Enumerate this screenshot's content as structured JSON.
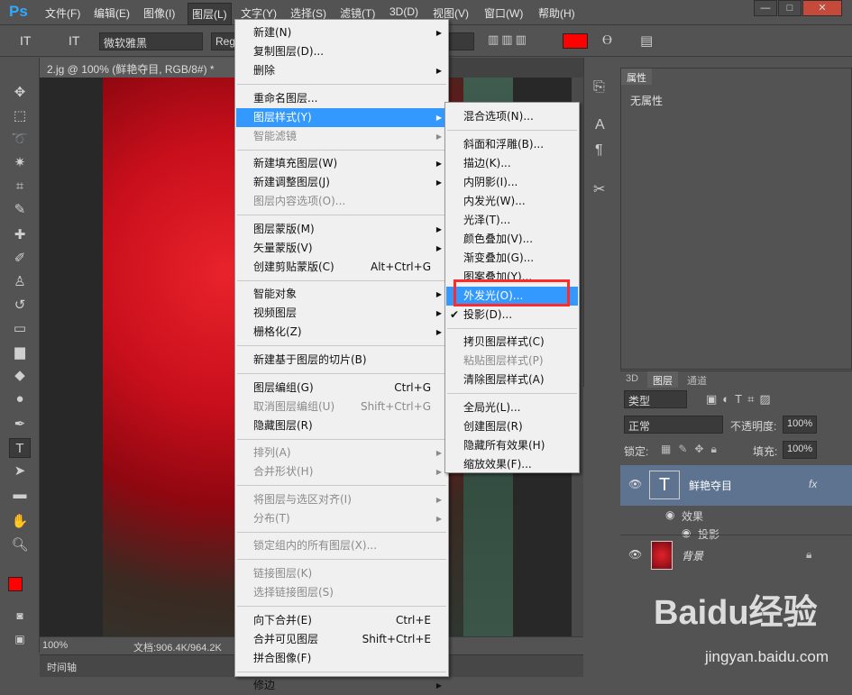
{
  "app": {
    "logo": "Ps"
  },
  "menubar": {
    "items": [
      "文件(F)",
      "编辑(E)",
      "图像(I)",
      "图层(L)",
      "文字(Y)",
      "选择(S)",
      "滤镜(T)",
      "3D(D)",
      "视图(V)",
      "窗口(W)",
      "帮助(H)"
    ],
    "window_buttons": [
      "—",
      "□",
      "✕"
    ]
  },
  "optbar": {
    "tool_glyph": "IT",
    "orient_glyph": "IT",
    "font_family": "微软雅黑",
    "font_style": "Reg",
    "color_hex": "#ff0000"
  },
  "document": {
    "tab_title": "2.jg @ 100% (鲜艳夺目, RGB/8#) *",
    "zoom": "100%",
    "doc_info": "文档:906.4K/964.2K",
    "timeline_label": "时间轴"
  },
  "properties": {
    "tab": "属性",
    "content": "无属性"
  },
  "layers": {
    "tabs": [
      "3D",
      "图层",
      "通道"
    ],
    "filter_kind": "类型",
    "blend_mode": "正常",
    "opacity_label": "不透明度:",
    "opacity": "100%",
    "lock_label": "锁定:",
    "fill_label": "填充:",
    "fill": "100%",
    "text_layer": {
      "name": "鲜艳夺目",
      "fx": "fx",
      "effects_label": "效果",
      "effect_item": "投影"
    },
    "bg_layer": {
      "name": "背景"
    }
  },
  "layer_menu": {
    "items": [
      {
        "label": "新建(N)",
        "sub": true
      },
      {
        "label": "复制图层(D)..."
      },
      {
        "label": "删除",
        "sub": true
      },
      {
        "sep": true
      },
      {
        "label": "重命名图层..."
      },
      {
        "label": "图层样式(Y)",
        "sub": true,
        "hl": true
      },
      {
        "label": "智能滤镜",
        "sub": true,
        "dis": true
      },
      {
        "sep": true
      },
      {
        "label": "新建填充图层(W)",
        "sub": true
      },
      {
        "label": "新建调整图层(J)",
        "sub": true
      },
      {
        "label": "图层内容选项(O)...",
        "dis": true
      },
      {
        "sep": true
      },
      {
        "label": "图层蒙版(M)",
        "sub": true
      },
      {
        "label": "矢量蒙版(V)",
        "sub": true
      },
      {
        "label": "创建剪贴蒙版(C)",
        "sc": "Alt+Ctrl+G"
      },
      {
        "sep": true
      },
      {
        "label": "智能对象",
        "sub": true
      },
      {
        "label": "视频图层",
        "sub": true
      },
      {
        "label": "栅格化(Z)",
        "sub": true
      },
      {
        "sep": true
      },
      {
        "label": "新建基于图层的切片(B)"
      },
      {
        "sep": true
      },
      {
        "label": "图层编组(G)",
        "sc": "Ctrl+G"
      },
      {
        "label": "取消图层编组(U)",
        "sc": "Shift+Ctrl+G",
        "dis": true
      },
      {
        "label": "隐藏图层(R)"
      },
      {
        "sep": true
      },
      {
        "label": "排列(A)",
        "sub": true,
        "dis": true
      },
      {
        "label": "合并形状(H)",
        "sub": true,
        "dis": true
      },
      {
        "sep": true
      },
      {
        "label": "将图层与选区对齐(I)",
        "sub": true,
        "dis": true
      },
      {
        "label": "分布(T)",
        "sub": true,
        "dis": true
      },
      {
        "sep": true
      },
      {
        "label": "锁定组内的所有图层(X)...",
        "dis": true
      },
      {
        "sep": true
      },
      {
        "label": "链接图层(K)",
        "dis": true
      },
      {
        "label": "选择链接图层(S)",
        "dis": true
      },
      {
        "sep": true
      },
      {
        "label": "向下合并(E)",
        "sc": "Ctrl+E"
      },
      {
        "label": "合并可见图层",
        "sc": "Shift+Ctrl+E"
      },
      {
        "label": "拼合图像(F)"
      },
      {
        "sep": true
      },
      {
        "label": "修边",
        "sub": true
      }
    ]
  },
  "style_submenu": {
    "items": [
      {
        "label": "混合选项(N)..."
      },
      {
        "sep": true
      },
      {
        "label": "斜面和浮雕(B)..."
      },
      {
        "label": "描边(K)..."
      },
      {
        "label": "内阴影(I)..."
      },
      {
        "label": "内发光(W)..."
      },
      {
        "label": "光泽(T)..."
      },
      {
        "label": "颜色叠加(V)..."
      },
      {
        "label": "渐变叠加(G)..."
      },
      {
        "label": "图案叠加(Y)..."
      },
      {
        "label": "外发光(O)...",
        "hl": true
      },
      {
        "label": "投影(D)...",
        "check": true
      },
      {
        "sep": true
      },
      {
        "label": "拷贝图层样式(C)"
      },
      {
        "label": "粘贴图层样式(P)",
        "dis": true
      },
      {
        "label": "清除图层样式(A)"
      },
      {
        "sep": true
      },
      {
        "label": "全局光(L)..."
      },
      {
        "label": "创建图层(R)"
      },
      {
        "label": "隐藏所有效果(H)"
      },
      {
        "label": "缩放效果(F)..."
      }
    ]
  },
  "watermark": {
    "text": "Baidu经验",
    "url": "jingyan.baidu.com"
  },
  "colors": {
    "highlight": "#3399ff",
    "annotation": "#ff2a2a",
    "foreground": "#ff0000",
    "background": "#ffffff"
  }
}
